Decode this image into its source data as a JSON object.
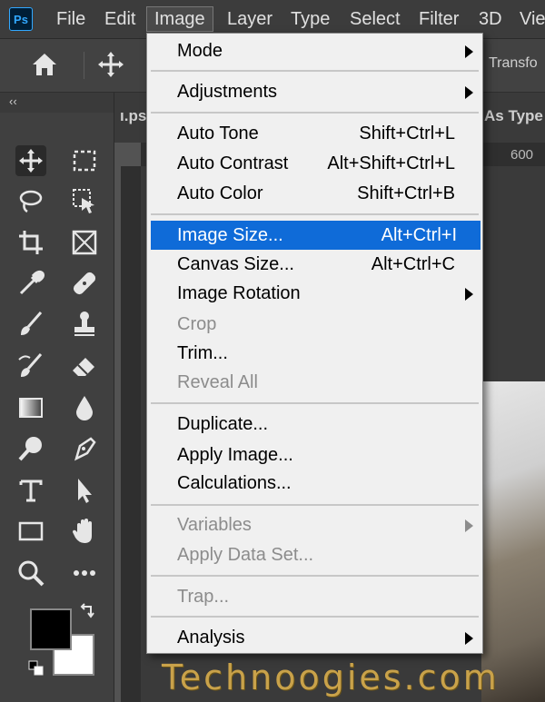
{
  "app": {
    "logo": "Ps"
  },
  "menubar": {
    "items": [
      "File",
      "Edit",
      "Image",
      "Layer",
      "Type",
      "Select",
      "Filter",
      "3D",
      "Vie"
    ],
    "active": "Image"
  },
  "options_bar": {
    "right_text": "Transfo"
  },
  "document": {
    "tab_left": "ı.ps",
    "tab_right": "As Type",
    "ruler_value": "600"
  },
  "toolbox": {
    "collapse_label": "‹‹",
    "tools": [
      "move-icon",
      "marquee-icon",
      "lasso-icon",
      "object-select-icon",
      "crop-icon",
      "frame-icon",
      "eyedropper-icon",
      "healing-icon",
      "brush-icon",
      "stamp-icon",
      "history-brush-icon",
      "eraser-icon",
      "gradient-icon",
      "blur-icon",
      "dodge-icon",
      "pen-icon",
      "type-icon",
      "path-select-icon",
      "rectangle-icon",
      "hand-icon",
      "zoom-icon",
      "more-icon"
    ],
    "fg_color": "#000000",
    "bg_color": "#ffffff"
  },
  "image_menu": {
    "items": [
      {
        "label": "Mode",
        "submenu": true
      },
      {
        "label": "Adjustments",
        "submenu": true
      },
      {
        "label": "Auto Tone",
        "shortcut": "Shift+Ctrl+L"
      },
      {
        "label": "Auto Contrast",
        "shortcut": "Alt+Shift+Ctrl+L"
      },
      {
        "label": "Auto Color",
        "shortcut": "Shift+Ctrl+B"
      },
      {
        "label": "Image Size...",
        "shortcut": "Alt+Ctrl+I",
        "highlighted": true
      },
      {
        "label": "Canvas Size...",
        "shortcut": "Alt+Ctrl+C"
      },
      {
        "label": "Image Rotation",
        "submenu": true
      },
      {
        "label": "Crop",
        "disabled": true
      },
      {
        "label": "Trim..."
      },
      {
        "label": "Reveal All",
        "disabled": true
      },
      {
        "label": "Duplicate..."
      },
      {
        "label": "Apply Image..."
      },
      {
        "label": "Calculations..."
      },
      {
        "label": "Variables",
        "submenu": true,
        "disabled": true
      },
      {
        "label": "Apply Data Set...",
        "disabled": true
      },
      {
        "label": "Trap...",
        "disabled": true
      },
      {
        "label": "Analysis",
        "submenu": true
      }
    ]
  },
  "colors": {
    "highlight": "#0f6bd8",
    "menu_bg": "#f0f0f0"
  },
  "watermark": "Technoogies.com"
}
